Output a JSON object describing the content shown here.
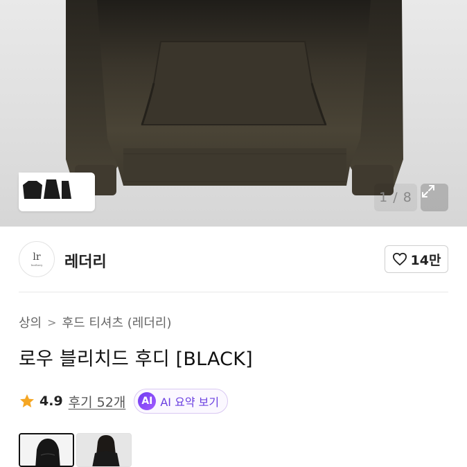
{
  "gallery": {
    "counter": "1 / 8",
    "thumb_chevron": "›",
    "expand_icon": "expand-arrows-icon"
  },
  "brand": {
    "name": "레더리",
    "logo_mark": "lr",
    "logo_text": "leathery"
  },
  "like": {
    "count": "14만",
    "icon": "heart-outline-icon"
  },
  "breadcrumb": {
    "items": [
      "상의",
      "후드 티셔츠 (레더리)"
    ],
    "separator": ">"
  },
  "product": {
    "title": "로우 블리치드 후디 [BLACK]"
  },
  "rating": {
    "score": "4.9",
    "reviews": "후기 52개",
    "star_color": "#f5a623"
  },
  "ai_summary": {
    "badge": "AI",
    "label": "AI 요약 보기",
    "accent": "#6a3fe0"
  },
  "variants": [
    {
      "name": "black-hoodie-front"
    },
    {
      "name": "model-photo"
    }
  ]
}
